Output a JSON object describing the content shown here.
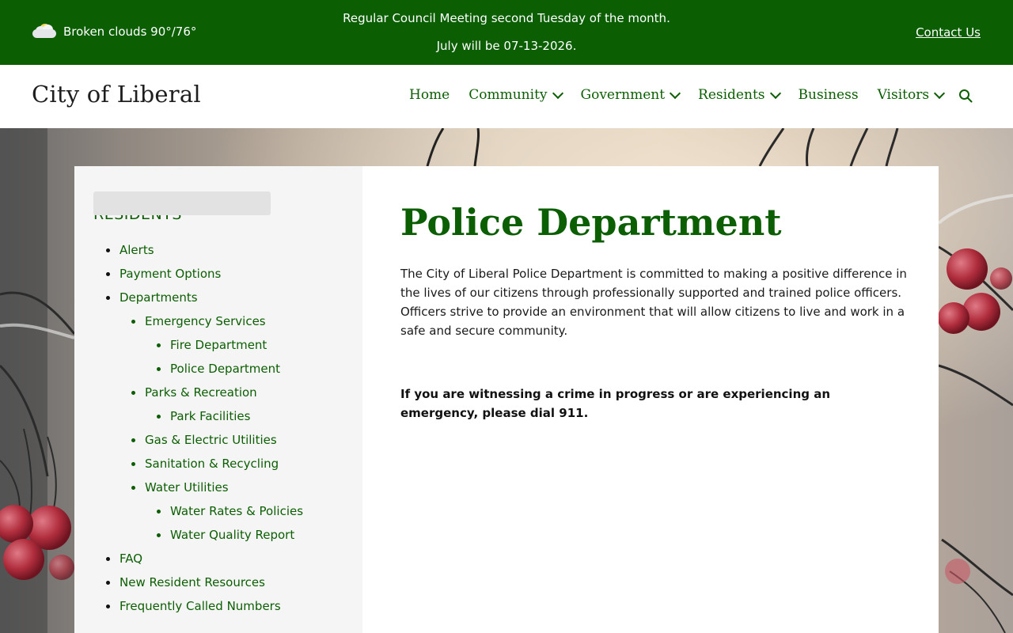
{
  "topbar": {
    "weather_icon": "partly-cloudy-icon",
    "weather_text": "Broken clouds 90°/76°",
    "announcement_line1": "Regular Council Meeting second Tuesday of the month.",
    "announcement_line2": "July will be 07-13-2026.",
    "contact_label": "Contact Us"
  },
  "header": {
    "site_title": "City of Liberal",
    "nav": [
      {
        "label": "Home",
        "dropdown": false
      },
      {
        "label": "Community",
        "dropdown": true
      },
      {
        "label": "Government",
        "dropdown": true
      },
      {
        "label": "Residents",
        "dropdown": true
      },
      {
        "label": "Business",
        "dropdown": false
      },
      {
        "label": "Visitors",
        "dropdown": true
      }
    ],
    "search_icon": "search-icon"
  },
  "sidebar": {
    "title": "RESIDENTS",
    "items": [
      {
        "label": "Alerts",
        "level": 0
      },
      {
        "label": "Payment Options",
        "level": 0
      },
      {
        "label": "Departments",
        "level": 0
      },
      {
        "label": "Emergency Services",
        "level": 1
      },
      {
        "label": "Fire Department",
        "level": 2
      },
      {
        "label": "Police Department",
        "level": 2,
        "active": true
      },
      {
        "label": "Parks & Recreation",
        "level": 1
      },
      {
        "label": "Park Facilities",
        "level": 2
      },
      {
        "label": "Gas & Electric Utilities",
        "level": 1
      },
      {
        "label": "Sanitation & Recycling",
        "level": 1
      },
      {
        "label": "Water Utilities",
        "level": 1
      },
      {
        "label": "Water Rates & Policies",
        "level": 2
      },
      {
        "label": "Water Quality Report",
        "level": 2
      },
      {
        "label": "FAQ",
        "level": 0
      },
      {
        "label": "New Resident Resources",
        "level": 0
      },
      {
        "label": "Frequently Called Numbers",
        "level": 0
      }
    ]
  },
  "main": {
    "title": "Police Department",
    "intro": "The City of Liberal Police Department is committed to making a positive difference in the lives of our citizens through professionally supported and trained police officers. Officers strive to provide an environment that will allow citizens to live and work in a safe and secure community.",
    "emergency": "If you are witnessing a crime in progress or are experiencing an emergency, please dial 911."
  },
  "colors": {
    "brand_green": "#0b5e02",
    "topbar_bg": "#0b5e02",
    "sidebar_bg": "#f5f5f5",
    "active_item_bg": "#e2e2e2"
  }
}
